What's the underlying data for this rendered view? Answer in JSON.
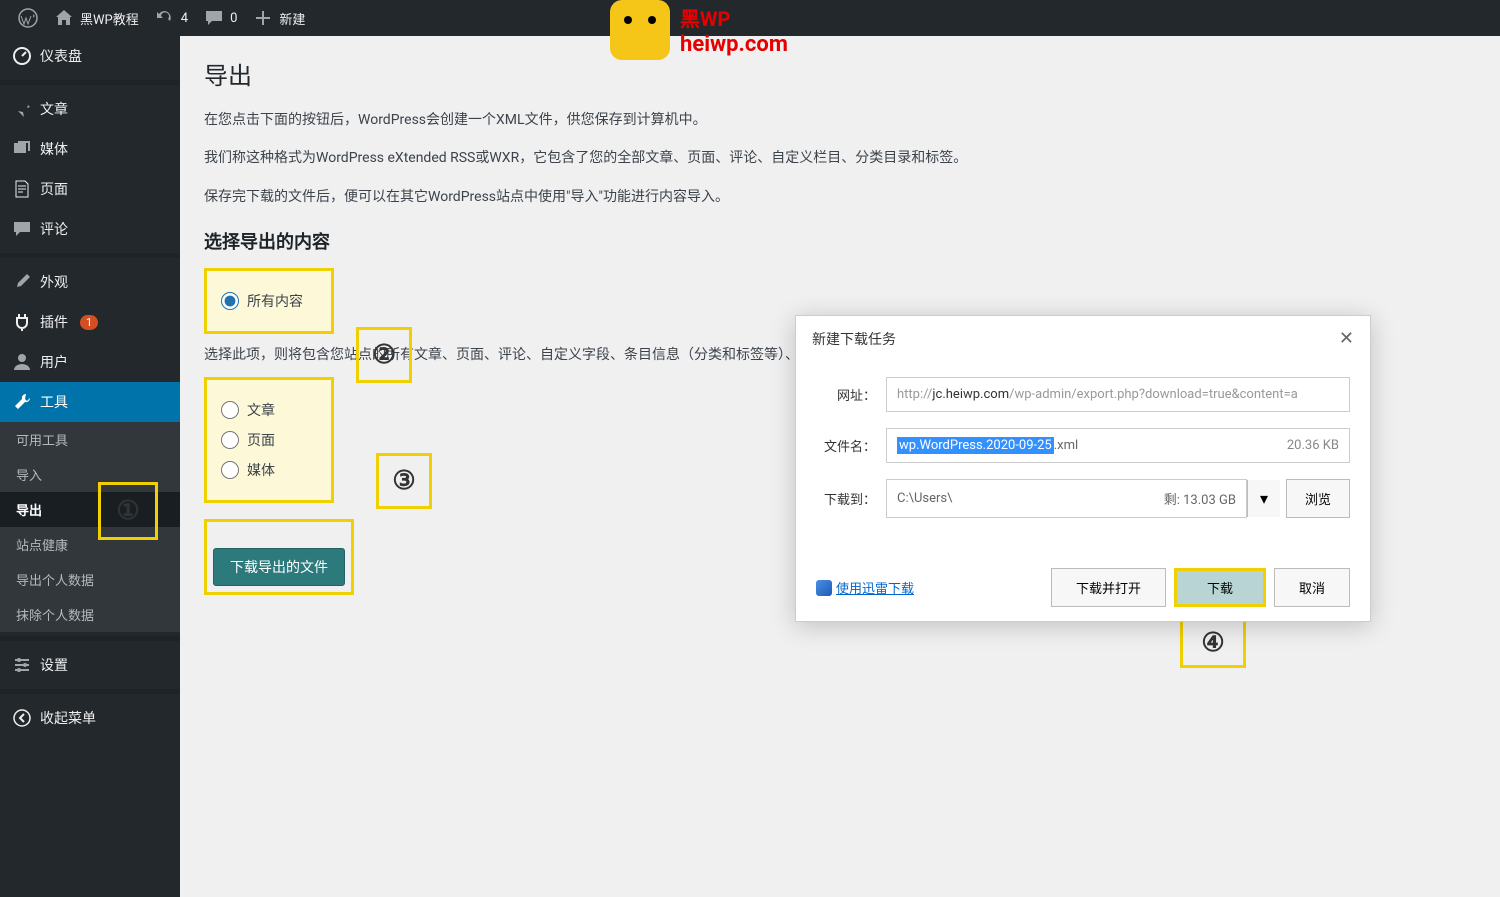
{
  "adminbar": {
    "site": "黑WP教程",
    "updates": "4",
    "comments": "0",
    "new": "新建"
  },
  "watermark": {
    "line1": "黑WP",
    "line2": "heiwp.com"
  },
  "sidebar": {
    "dashboard": "仪表盘",
    "posts": "文章",
    "media": "媒体",
    "pages": "页面",
    "comments": "评论",
    "appearance": "外观",
    "plugins": "插件",
    "plugins_badge": "1",
    "users": "用户",
    "tools": "工具",
    "available": "可用工具",
    "import": "导入",
    "export": "导出",
    "health": "站点健康",
    "export_personal": "导出个人数据",
    "erase_personal": "抹除个人数据",
    "settings": "设置",
    "collapse": "收起菜单"
  },
  "page": {
    "title": "导出",
    "p1": "在您点击下面的按钮后，WordPress会创建一个XML文件，供您保存到计算机中。",
    "p2": "我们称这种格式为WordPress eXtended RSS或WXR，它包含了您的全部文章、页面、评论、自定义栏目、分类目录和标签。",
    "p3": "保存完下载的文件后，便可以在其它WordPress站点中使用\"导入\"功能进行内容导入。",
    "h2": "选择导出的内容",
    "opt_all": "所有内容",
    "desc": "选择此项，则将包含您站点的所有文章、页面、评论、自定义字段、条目信息（分类和标签等）、导航菜单以及自定义文章。",
    "opt_posts": "文章",
    "opt_pages": "页面",
    "opt_media": "媒体",
    "download_btn": "下载导出的文件"
  },
  "markers": {
    "m1": "①",
    "m2": "②",
    "m3": "③",
    "m4": "④"
  },
  "dialog": {
    "title": "新建下载任务",
    "url_label": "网址：",
    "url_prefix": "http://",
    "url_host": "jc.heiwp.com",
    "url_path": "/wp-admin/export.php?download=true&content=a",
    "name_label": "文件名：",
    "name_sel": "wp.WordPress.2020-09-25",
    "name_ext": ".xml",
    "name_size": "20.36 KB",
    "dest_label": "下载到：",
    "dest_path": "C:\\Users\\",
    "dest_free": "剩: 13.03 GB",
    "browse": "浏览",
    "xunlei": "使用迅雷下载",
    "open": "下载并打开",
    "download": "下载",
    "cancel": "取消"
  }
}
